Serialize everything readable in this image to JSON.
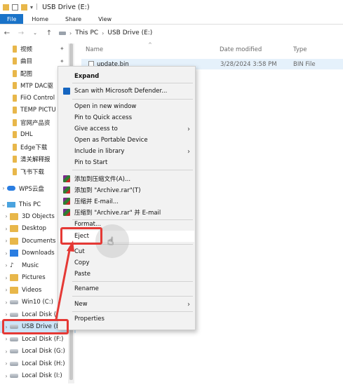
{
  "window": {
    "title": "USB Drive (E:)"
  },
  "ribbon": {
    "tabs": [
      "File",
      "Home",
      "Share",
      "View"
    ]
  },
  "address": {
    "path": [
      "This PC",
      "USB Drive (E:)"
    ]
  },
  "sidebar": {
    "quick_access": [
      {
        "label": "视频"
      },
      {
        "label": "曲目"
      },
      {
        "label": "配图"
      },
      {
        "label": "MTP DAC驱"
      },
      {
        "label": "FiiO Control"
      },
      {
        "label": "TEMP PICTU"
      },
      {
        "label": "官网产品资"
      },
      {
        "label": "DHL"
      },
      {
        "label": "Edge下载"
      },
      {
        "label": "清关解释报"
      },
      {
        "label": "飞书下载"
      }
    ],
    "wps": "WPS云盘",
    "this_pc": "This PC",
    "pc_items": [
      "3D Objects",
      "Desktop",
      "Documents",
      "Downloads",
      "Music",
      "Pictures",
      "Videos",
      "Win10 (C:)",
      "Local Disk (D:)",
      "USB Drive (E:)",
      "Local Disk (F:)",
      "Local Disk (G:)",
      "Local Disk (H:)",
      "Local Disk (I:)"
    ]
  },
  "columns": {
    "name": "Name",
    "date": "Date modified",
    "type": "Type"
  },
  "files": [
    {
      "name": "update.bin",
      "date": "3/28/2024 3:58 PM",
      "type": "BIN File"
    }
  ],
  "context_menu": {
    "expand": "Expand",
    "scan": "Scan with Microsoft Defender...",
    "open_new": "Open in new window",
    "pin_quick": "Pin to Quick access",
    "give_access": "Give access to",
    "open_portable": "Open as Portable Device",
    "include_library": "Include in library",
    "pin_start": "Pin to Start",
    "rar1": "添加到压缩文件(A)...",
    "rar2": "添加到 \"Archive.rar\"(T)",
    "rar3": "压缩并 E-mail...",
    "rar4": "压缩到 \"Archive.rar\" 并 E-mail",
    "format": "Format...",
    "eject": "Eject",
    "cut": "Cut",
    "copy": "Copy",
    "paste": "Paste",
    "rename": "Rename",
    "new": "New",
    "properties": "Properties"
  },
  "colors": {
    "accent": "#1a73c8",
    "highlight_red": "#e53935",
    "selection": "#cce4f7"
  }
}
